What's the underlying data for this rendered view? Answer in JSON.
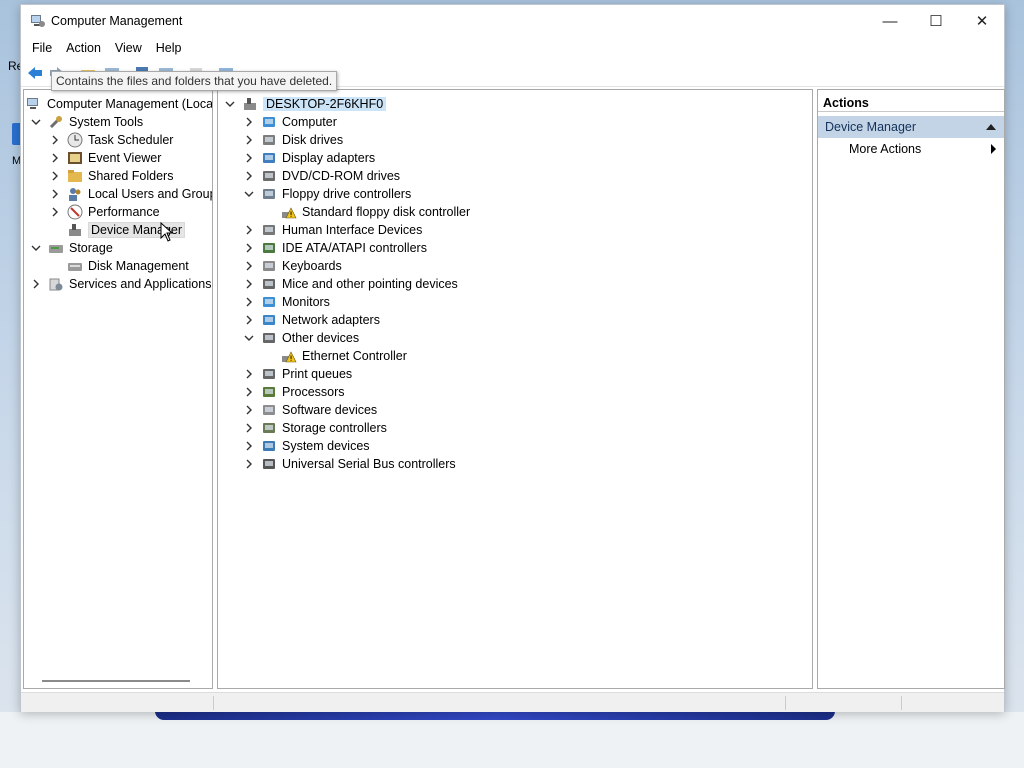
{
  "desktop": {
    "icon_label_1": "Re",
    "icon_label_2": "M"
  },
  "window": {
    "title": "Computer Management",
    "minimize": "—",
    "maximize": "☐",
    "close": "✕"
  },
  "menu": [
    "File",
    "Action",
    "View",
    "Help"
  ],
  "tooltip": "Contains the files and folders that you have deleted.",
  "left_tree": {
    "root": "Computer Management (Local",
    "system_tools": "System Tools",
    "task_scheduler": "Task Scheduler",
    "event_viewer": "Event Viewer",
    "shared_folders": "Shared Folders",
    "local_users": "Local Users and Groups",
    "performance": "Performance",
    "device_manager": "Device Manager",
    "storage": "Storage",
    "disk_management": "Disk Management",
    "services": "Services and Applications"
  },
  "devices": {
    "root": "DESKTOP-2F6KHF0",
    "items": [
      {
        "label": "Computer",
        "expanded": false,
        "icon": "monitor-icon"
      },
      {
        "label": "Disk drives",
        "expanded": false,
        "icon": "disk-drive-icon"
      },
      {
        "label": "Display adapters",
        "expanded": false,
        "icon": "display-adapter-icon"
      },
      {
        "label": "DVD/CD-ROM drives",
        "expanded": false,
        "icon": "dvd-icon"
      },
      {
        "label": "Floppy drive controllers",
        "expanded": true,
        "icon": "floppy-controller-icon"
      },
      {
        "label": "Standard floppy disk controller",
        "child": true,
        "icon": "warning-device-icon"
      },
      {
        "label": "Human Interface Devices",
        "expanded": false,
        "icon": "hid-icon"
      },
      {
        "label": "IDE ATA/ATAPI controllers",
        "expanded": false,
        "icon": "ide-icon"
      },
      {
        "label": "Keyboards",
        "expanded": false,
        "icon": "keyboard-icon"
      },
      {
        "label": "Mice and other pointing devices",
        "expanded": false,
        "icon": "mouse-icon"
      },
      {
        "label": "Monitors",
        "expanded": false,
        "icon": "monitor-icon"
      },
      {
        "label": "Network adapters",
        "expanded": false,
        "icon": "network-adapter-icon"
      },
      {
        "label": "Other devices",
        "expanded": true,
        "icon": "unknown-device-icon"
      },
      {
        "label": "Ethernet Controller",
        "child": true,
        "icon": "warning-device-icon"
      },
      {
        "label": "Print queues",
        "expanded": false,
        "icon": "printer-icon"
      },
      {
        "label": "Processors",
        "expanded": false,
        "icon": "processor-icon"
      },
      {
        "label": "Software devices",
        "expanded": false,
        "icon": "software-device-icon"
      },
      {
        "label": "Storage controllers",
        "expanded": false,
        "icon": "storage-controller-icon"
      },
      {
        "label": "System devices",
        "expanded": false,
        "icon": "system-device-icon"
      },
      {
        "label": "Universal Serial Bus controllers",
        "expanded": false,
        "icon": "usb-icon"
      }
    ]
  },
  "actions": {
    "header": "Actions",
    "section": "Device Manager",
    "more": "More Actions"
  }
}
